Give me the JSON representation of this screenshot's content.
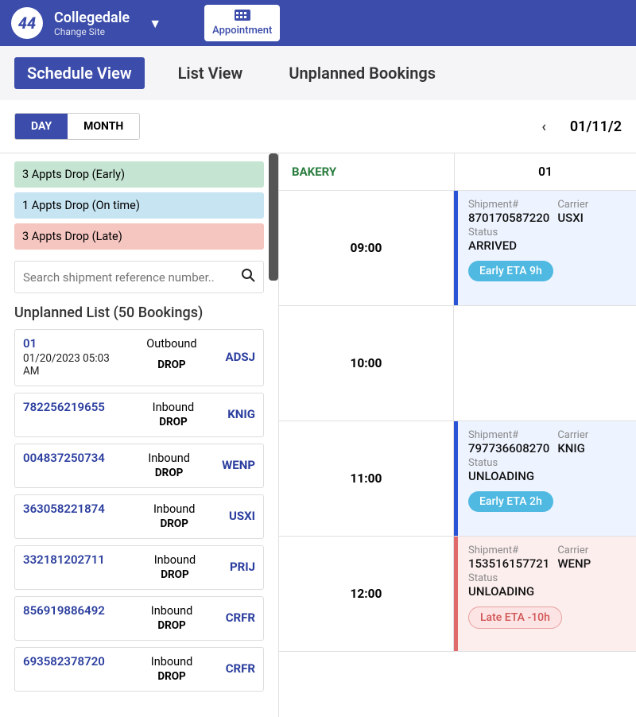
{
  "header": {
    "logo_text": "44",
    "site_name": "Collegedale",
    "change_site": "Change Site",
    "appointment_label": "Appointment"
  },
  "tabs": {
    "schedule": "Schedule View",
    "list": "List View",
    "unplanned": "Unplanned Bookings"
  },
  "toolbar": {
    "day": "DAY",
    "month": "MONTH",
    "date": "01/11/2"
  },
  "filters": {
    "early": "3 Appts Drop (Early)",
    "ontime": "1 Appts Drop (On time)",
    "late": "3 Appts Drop (Late)"
  },
  "search": {
    "placeholder": "Search shipment reference number.."
  },
  "unplanned_title": "Unplanned List (50 Bookings)",
  "unplanned": [
    {
      "id": "01",
      "sub": "01/20/2023 05:03 AM",
      "dir": "Outbound",
      "drop": "DROP",
      "carrier": "ADSJ"
    },
    {
      "id": "782256219655",
      "sub": "",
      "dir": "Inbound",
      "drop": "DROP",
      "carrier": "KNIG"
    },
    {
      "id": "004837250734",
      "sub": "",
      "dir": "Inbound",
      "drop": "DROP",
      "carrier": "WENP"
    },
    {
      "id": "363058221874",
      "sub": "",
      "dir": "Inbound",
      "drop": "DROP",
      "carrier": "USXI"
    },
    {
      "id": "332181202711",
      "sub": "",
      "dir": "Inbound",
      "drop": "DROP",
      "carrier": "PRIJ"
    },
    {
      "id": "856919886492",
      "sub": "",
      "dir": "Inbound",
      "drop": "DROP",
      "carrier": "CRFR"
    },
    {
      "id": "693582378720",
      "sub": "",
      "dir": "Inbound",
      "drop": "DROP",
      "carrier": "CRFR"
    }
  ],
  "schedule": {
    "col_label": "BAKERY",
    "day_label": "01",
    "labels": {
      "shipment": "Shipment#",
      "carrier": "Carrier",
      "status": "Status"
    },
    "rows": [
      {
        "time": "09:00",
        "shipment": "870170587220",
        "carrier": "USXI",
        "status": "ARRIVED",
        "eta": "Early ETA 9h",
        "eta_type": "early",
        "tint": "blue"
      },
      {
        "time": "10:00",
        "empty": true
      },
      {
        "time": "11:00",
        "shipment": "797736608270",
        "carrier": "KNIG",
        "status": "UNLOADING",
        "eta": "Early ETA 2h",
        "eta_type": "early",
        "tint": "blue"
      },
      {
        "time": "12:00",
        "shipment": "153516157721",
        "carrier": "WENP",
        "status": "UNLOADING",
        "eta": "Late ETA -10h",
        "eta_type": "late",
        "tint": "red"
      }
    ]
  }
}
